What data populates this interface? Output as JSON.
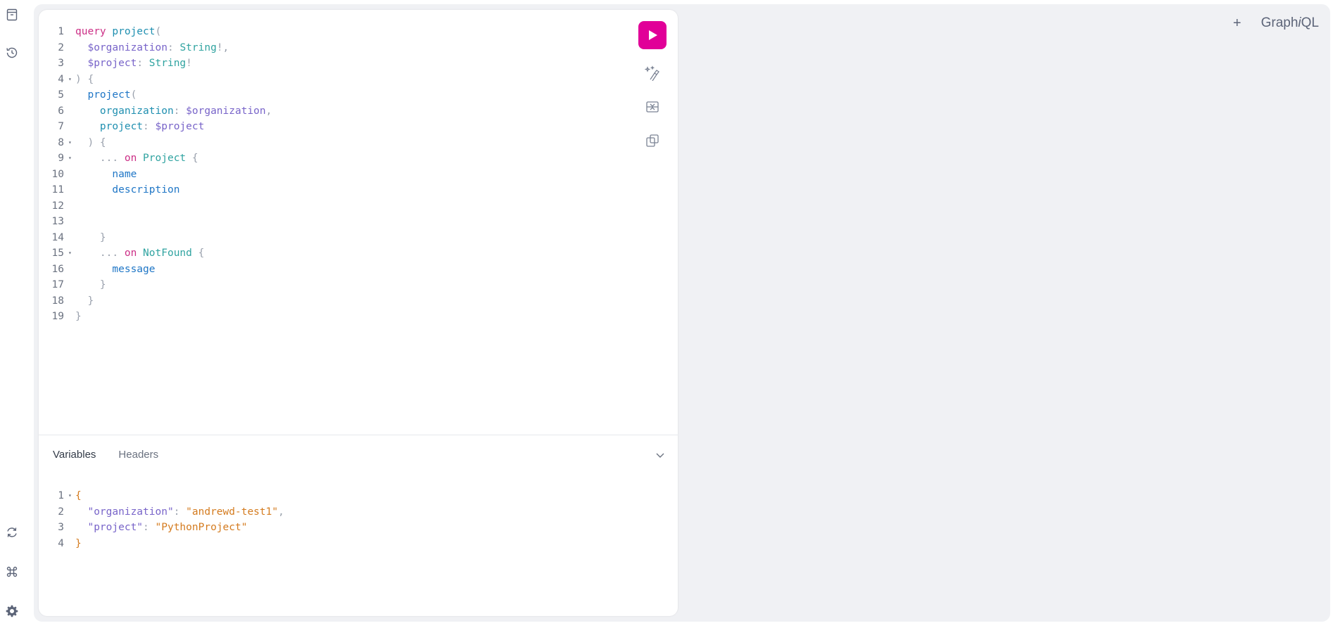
{
  "sidebar": {
    "top_icons": [
      "docs-icon",
      "history-icon"
    ],
    "bottom_icons": [
      "refetch-schema-icon",
      "keyboard-shortcuts-icon",
      "settings-icon"
    ]
  },
  "header": {
    "add_tab_label": "+",
    "logo_prefix": "Graph",
    "logo_italic": "i",
    "logo_suffix": "QL"
  },
  "editor": {
    "query_lines": [
      {
        "n": "1",
        "fold": false,
        "tokens": [
          [
            "kw",
            "query"
          ],
          [
            "sp",
            " "
          ],
          [
            "def",
            "project"
          ],
          [
            "punct",
            "("
          ]
        ]
      },
      {
        "n": "2",
        "fold": false,
        "tokens": [
          [
            "sp",
            "  "
          ],
          [
            "var",
            "$organization"
          ],
          [
            "punct",
            ": "
          ],
          [
            "type",
            "String"
          ],
          [
            "punct",
            "!,"
          ]
        ]
      },
      {
        "n": "3",
        "fold": false,
        "tokens": [
          [
            "sp",
            "  "
          ],
          [
            "var",
            "$project"
          ],
          [
            "punct",
            ": "
          ],
          [
            "type",
            "String"
          ],
          [
            "punct",
            "!"
          ]
        ]
      },
      {
        "n": "4",
        "fold": true,
        "tokens": [
          [
            "punct",
            ") {"
          ]
        ]
      },
      {
        "n": "5",
        "fold": false,
        "tokens": [
          [
            "sp",
            "  "
          ],
          [
            "field",
            "project"
          ],
          [
            "punct",
            "("
          ]
        ]
      },
      {
        "n": "6",
        "fold": false,
        "tokens": [
          [
            "sp",
            "    "
          ],
          [
            "def",
            "organization"
          ],
          [
            "punct",
            ": "
          ],
          [
            "var",
            "$organization"
          ],
          [
            "punct",
            ","
          ]
        ]
      },
      {
        "n": "7",
        "fold": false,
        "tokens": [
          [
            "sp",
            "    "
          ],
          [
            "def",
            "project"
          ],
          [
            "punct",
            ": "
          ],
          [
            "var",
            "$project"
          ]
        ]
      },
      {
        "n": "8",
        "fold": true,
        "tokens": [
          [
            "sp",
            "  "
          ],
          [
            "punct",
            ") {"
          ]
        ]
      },
      {
        "n": "9",
        "fold": true,
        "tokens": [
          [
            "sp",
            "    "
          ],
          [
            "punct",
            "... "
          ],
          [
            "kw",
            "on"
          ],
          [
            "sp",
            " "
          ],
          [
            "type",
            "Project"
          ],
          [
            "punct",
            " {"
          ]
        ]
      },
      {
        "n": "10",
        "fold": false,
        "tokens": [
          [
            "sp",
            "      "
          ],
          [
            "field",
            "name"
          ]
        ]
      },
      {
        "n": "11",
        "fold": false,
        "tokens": [
          [
            "sp",
            "      "
          ],
          [
            "field",
            "description"
          ]
        ]
      },
      {
        "n": "12",
        "fold": false,
        "tokens": []
      },
      {
        "n": "13",
        "fold": false,
        "tokens": []
      },
      {
        "n": "14",
        "fold": false,
        "tokens": [
          [
            "sp",
            "    "
          ],
          [
            "punct",
            "}"
          ]
        ]
      },
      {
        "n": "15",
        "fold": true,
        "tokens": [
          [
            "sp",
            "    "
          ],
          [
            "punct",
            "... "
          ],
          [
            "kw",
            "on"
          ],
          [
            "sp",
            " "
          ],
          [
            "type",
            "NotFound"
          ],
          [
            "punct",
            " {"
          ]
        ]
      },
      {
        "n": "16",
        "fold": false,
        "tokens": [
          [
            "sp",
            "      "
          ],
          [
            "field",
            "message"
          ]
        ]
      },
      {
        "n": "17",
        "fold": false,
        "tokens": [
          [
            "sp",
            "    "
          ],
          [
            "punct",
            "}"
          ]
        ]
      },
      {
        "n": "18",
        "fold": false,
        "tokens": [
          [
            "sp",
            "  "
          ],
          [
            "punct",
            "}"
          ]
        ]
      },
      {
        "n": "19",
        "fold": false,
        "tokens": [
          [
            "punct",
            "}"
          ]
        ]
      }
    ],
    "toolbar": {
      "run_icon": "play-icon",
      "tools": [
        "prettify-icon",
        "merge-fragments-icon",
        "copy-icon"
      ]
    }
  },
  "tabs": {
    "variables": "Variables",
    "headers": "Headers",
    "active": "Variables"
  },
  "variables_lines": [
    {
      "n": "1",
      "fold": true,
      "tokens": [
        [
          "str",
          "{"
        ]
      ]
    },
    {
      "n": "2",
      "fold": false,
      "tokens": [
        [
          "sp",
          "  "
        ],
        [
          "prop",
          "\"organization\""
        ],
        [
          "punct",
          ": "
        ],
        [
          "str",
          "\"andrewd-test1\""
        ],
        [
          "punct",
          ","
        ]
      ]
    },
    {
      "n": "3",
      "fold": false,
      "tokens": [
        [
          "sp",
          "  "
        ],
        [
          "prop",
          "\"project\""
        ],
        [
          "punct",
          ": "
        ],
        [
          "str",
          "\"PythonProject\""
        ]
      ]
    },
    {
      "n": "4",
      "fold": false,
      "tokens": [
        [
          "str",
          "}"
        ]
      ]
    }
  ],
  "colors": {
    "accent": "#e10098",
    "background": "#f0f1f4",
    "card": "#ffffff"
  }
}
